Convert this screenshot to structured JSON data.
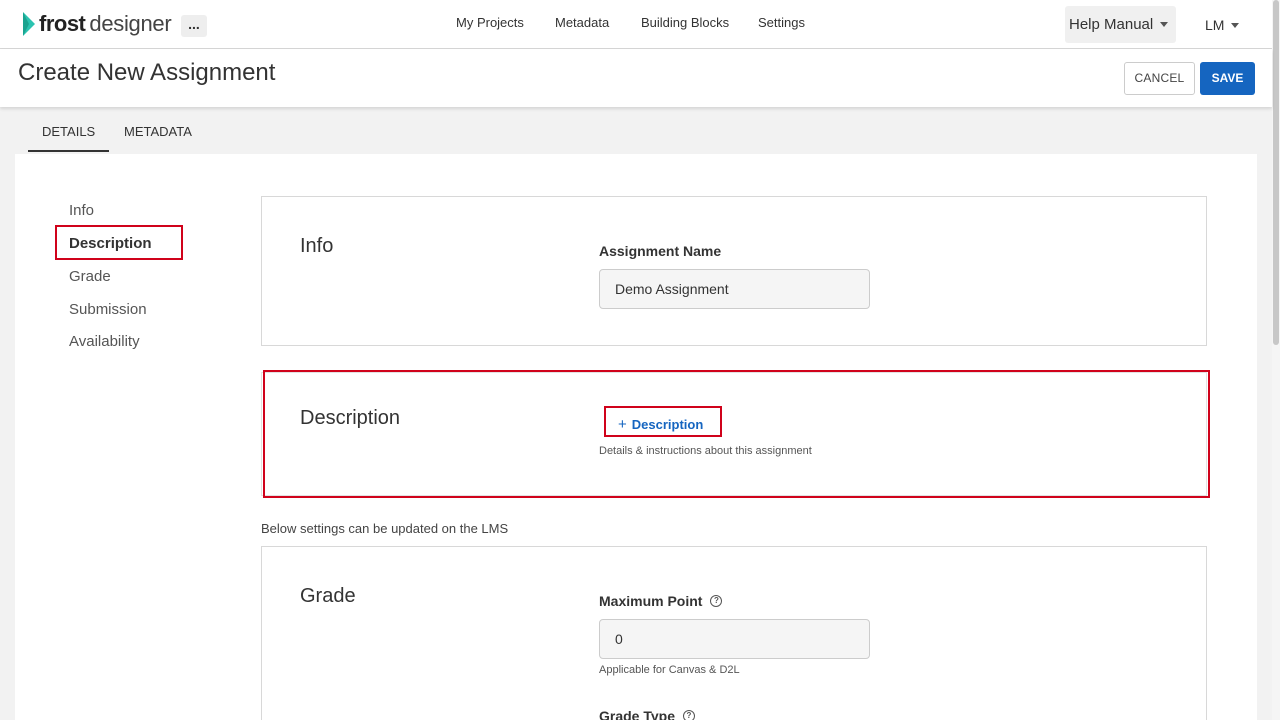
{
  "brand": {
    "name_bold": "frost",
    "name_rest": "designer",
    "accent": "#2bc3b0"
  },
  "topnav": {
    "more_label": "...",
    "items": [
      "My Projects",
      "Metadata",
      "Building Blocks",
      "Settings"
    ],
    "help_label": "Help Manual",
    "user_label": "LM"
  },
  "header": {
    "title": "Create New Assignment",
    "cancel_label": "CANCEL",
    "save_label": "SAVE"
  },
  "tabs": [
    {
      "label": "DETAILS",
      "active": true
    },
    {
      "label": "METADATA",
      "active": false
    }
  ],
  "sidebar": {
    "items": [
      {
        "label": "Info"
      },
      {
        "label": "Description",
        "active": true
      },
      {
        "label": "Grade"
      },
      {
        "label": "Submission"
      },
      {
        "label": "Availability"
      }
    ]
  },
  "info_section": {
    "title": "Info",
    "name_label": "Assignment Name",
    "name_value": "Demo Assignment"
  },
  "description_section": {
    "title": "Description",
    "add_label": "Description",
    "help": "Details & instructions about this assignment"
  },
  "lms_note": "Below settings can be updated on the LMS",
  "grade_section": {
    "title": "Grade",
    "max_point_label": "Maximum Point",
    "max_point_value": "0",
    "max_point_help": "Applicable for Canvas & D2L",
    "grade_type_label": "Grade Type"
  },
  "colors": {
    "primary": "#1565c0",
    "highlight": "#d0021b"
  }
}
